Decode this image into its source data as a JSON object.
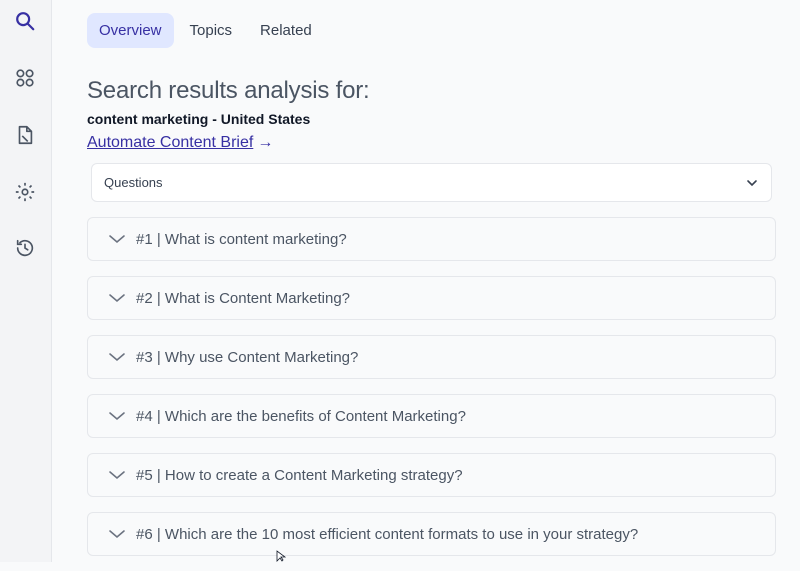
{
  "sidebar": {
    "icons": [
      "search-icon",
      "dashboard-icon",
      "document-icon",
      "settings-icon",
      "history-icon"
    ],
    "active_color": "#3730a3"
  },
  "tabs": [
    {
      "label": "Overview",
      "active": true
    },
    {
      "label": "Topics",
      "active": false
    },
    {
      "label": "Related",
      "active": false
    }
  ],
  "page": {
    "heading": "Search results analysis for:",
    "query": "content marketing - United States",
    "brief_link": "Automate Content Brief",
    "brief_arrow": "→"
  },
  "filter": {
    "selected": "Questions"
  },
  "questions": [
    {
      "label": "#1 | What is content marketing?"
    },
    {
      "label": "#2 | What is Content Marketing?"
    },
    {
      "label": "#3 | Why use Content Marketing?"
    },
    {
      "label": "#4 | Which are the benefits of Content Marketing?"
    },
    {
      "label": "#5 | How to create a Content Marketing strategy?"
    },
    {
      "label": "#6 | Which are the 10 most efficient content formats to use in your strategy?"
    }
  ]
}
